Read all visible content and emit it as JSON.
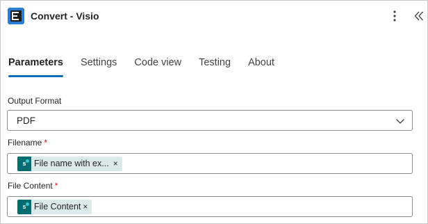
{
  "header": {
    "title": "Convert - Visio",
    "app_icon": "encodian-logo-icon",
    "more_icon": "more-vertical-icon",
    "collapse_icon": "double-chevron-left-icon"
  },
  "tabs": [
    {
      "label": "Parameters",
      "active": true
    },
    {
      "label": "Settings",
      "active": false
    },
    {
      "label": "Code view",
      "active": false
    },
    {
      "label": "Testing",
      "active": false
    },
    {
      "label": "About",
      "active": false
    }
  ],
  "fields": {
    "output_format": {
      "label": "Output Format",
      "value": "PDF"
    },
    "filename": {
      "label": "Filename",
      "required_marker": "*",
      "token_text": "File name with ex...",
      "token_icon_text": "s",
      "remove": "×"
    },
    "file_content": {
      "label": "File Content",
      "required_marker": "*",
      "token_text": "File Content",
      "token_icon_text": "s",
      "remove": "×"
    }
  },
  "colors": {
    "accent": "#0f6cbd",
    "required": "#c50f1f",
    "sharepoint": "#036c70",
    "token_bg": "#dbeae8"
  }
}
